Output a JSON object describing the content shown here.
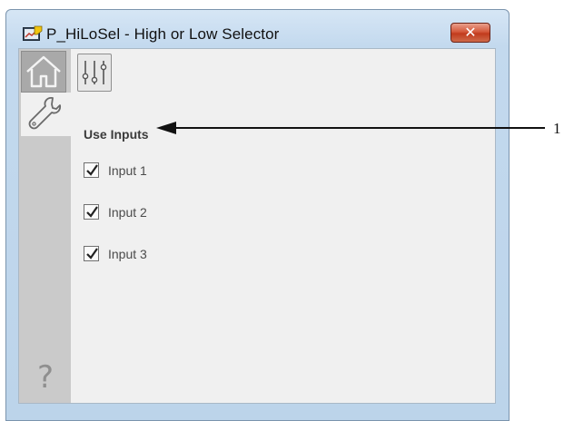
{
  "window": {
    "title": "P_HiLoSel - High or Low Selector",
    "close_label": "✕"
  },
  "sidebar": {
    "items": [
      {
        "name": "home",
        "icon": "home-icon",
        "selected": false
      },
      {
        "name": "maintenance",
        "icon": "wrench-icon",
        "selected": true
      },
      {
        "name": "help",
        "icon": "help-icon",
        "glyph": "?"
      }
    ]
  },
  "tabs": [
    {
      "name": "tuning",
      "icon": "sliders-icon",
      "selected": true
    }
  ],
  "main": {
    "section_label": "Use Inputs",
    "inputs": [
      {
        "label": "Input 1",
        "checked": true
      },
      {
        "label": "Input 2",
        "checked": true
      },
      {
        "label": "Input 3",
        "checked": true
      }
    ]
  },
  "callout": {
    "number": "1"
  },
  "colors": {
    "title_bar": "#c3d9ee",
    "close_button": "#c13a1c",
    "sidebar": "#cacaca",
    "panel": "#f0f0f0"
  }
}
